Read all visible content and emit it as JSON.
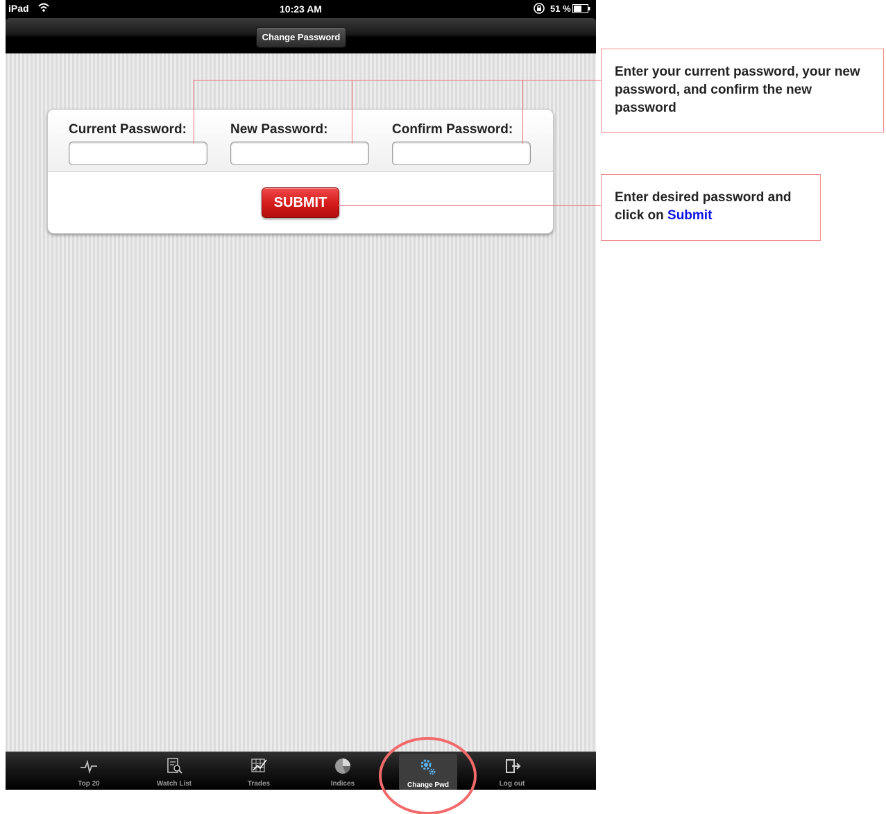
{
  "status_bar": {
    "carrier": "iPad",
    "time": "10:23 AM",
    "battery_percent": "51 %"
  },
  "nav_bar": {
    "title": "Change Password"
  },
  "form": {
    "current_password_label": "Current Password:",
    "new_password_label": "New Password:",
    "confirm_password_label": "Confirm Password:",
    "submit_label": "SUBMIT"
  },
  "tab_bar": {
    "tabs": [
      {
        "label": "Top 20",
        "icon": "pulse-icon"
      },
      {
        "label": "Watch List",
        "icon": "document-search-icon"
      },
      {
        "label": "Trades",
        "icon": "chart-grid-icon"
      },
      {
        "label": "Indices",
        "icon": "pie-chart-icon"
      },
      {
        "label": "Change Pwd",
        "icon": "gears-icon",
        "active": true
      },
      {
        "label": "Log out",
        "icon": "logout-icon"
      }
    ]
  },
  "annotations": {
    "callout_1": "Enter your current password, your new password, and confirm the new password",
    "callout_2_prefix": "Enter desired password and click on ",
    "callout_2_highlight": "Submit",
    "highlight_color": "#0a12e8",
    "line_color": "#e8737a"
  }
}
